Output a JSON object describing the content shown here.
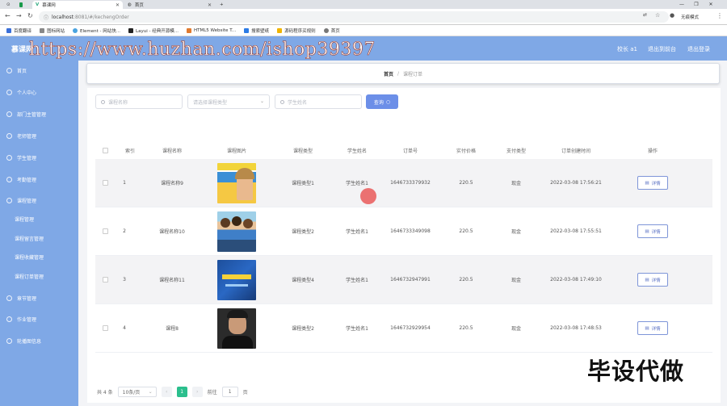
{
  "browser": {
    "tabs": [
      {
        "label": "慕课网"
      },
      {
        "label": "首页"
      }
    ],
    "url_host": "localhost",
    "url_path": ":8081/#/kechengOrder",
    "guest_label": "无痕模式",
    "bookmarks": [
      "百度翻译",
      "图标网站",
      "Element - 网站快...",
      "Layui - 经典开源模...",
      "HTML5 Website T...",
      "搜索壁纸",
      "源码程序买规则",
      "首页"
    ]
  },
  "header": {
    "brand": "慕课网",
    "watermark": "https://www.huzhan.com/ishop39397",
    "user": "校长 a1",
    "exit_front": "退出到前台",
    "logout": "退出登录"
  },
  "sidebar": {
    "items": [
      {
        "label": "首页"
      },
      {
        "label": "个人中心"
      },
      {
        "label": "部门主管管理"
      },
      {
        "label": "老师管理"
      },
      {
        "label": "学生管理"
      },
      {
        "label": "考勤管理"
      },
      {
        "label": "课程管理"
      }
    ],
    "subitems": [
      {
        "label": "课程管理"
      },
      {
        "label": "课程留言管理"
      },
      {
        "label": "课程收藏管理"
      },
      {
        "label": "课程订单管理"
      }
    ],
    "tail_items": [
      {
        "label": "章节管理"
      },
      {
        "label": "作业管理"
      },
      {
        "label": "轮播图信息"
      }
    ]
  },
  "breadcrumb": {
    "home": "首页",
    "sep": "/",
    "current": "课程订单"
  },
  "search": {
    "course_name_placeholder": "课程名称",
    "course_type_placeholder": "请选择课程类型",
    "student_name_placeholder": "学生姓名",
    "button": "查询"
  },
  "table": {
    "headers": [
      "索引",
      "课程名称",
      "课程图片",
      "课程类型",
      "学生姓名",
      "订单号",
      "实付价格",
      "支付类型",
      "订单创建时间",
      "操作"
    ],
    "rows": [
      {
        "index": "1",
        "name": "课程名称9",
        "type": "课程类型1",
        "student": "学生姓名1",
        "order": "1646733379932",
        "price": "220.5",
        "pay": "现金",
        "time": "2022-03-08 17:56:21",
        "image": "book-cover-woman",
        "action": "详情"
      },
      {
        "index": "2",
        "name": "课程名称10",
        "type": "课程类型2",
        "student": "学生姓名1",
        "order": "1646733349098",
        "price": "220.5",
        "pay": "现金",
        "time": "2022-03-08 17:55:51",
        "image": "students-group",
        "action": "详情"
      },
      {
        "index": "3",
        "name": "课程名称11",
        "type": "课程类型4",
        "student": "学生姓名1",
        "order": "1646732947991",
        "price": "220.5",
        "pay": "现金",
        "time": "2022-03-08 17:49:10",
        "image": "blue-book-cover",
        "action": "详情"
      },
      {
        "index": "4",
        "name": "课程8",
        "type": "课程类型2",
        "student": "学生姓名1",
        "order": "1646732929954",
        "price": "220.5",
        "pay": "现金",
        "time": "2022-03-08 17:48:53",
        "image": "man-portrait",
        "action": "详情"
      }
    ]
  },
  "pager": {
    "total": "共 4 条",
    "page_size": "10条/页",
    "prev": "‹",
    "current": "1",
    "next": "›",
    "goto_label": "前往",
    "goto_value": "1",
    "page_suffix": "页"
  },
  "overlay_text": "毕设代做",
  "colors": {
    "header": "#7fa8e6",
    "primary_button": "#6c8fe8",
    "pager_active": "#2bbf8d"
  }
}
